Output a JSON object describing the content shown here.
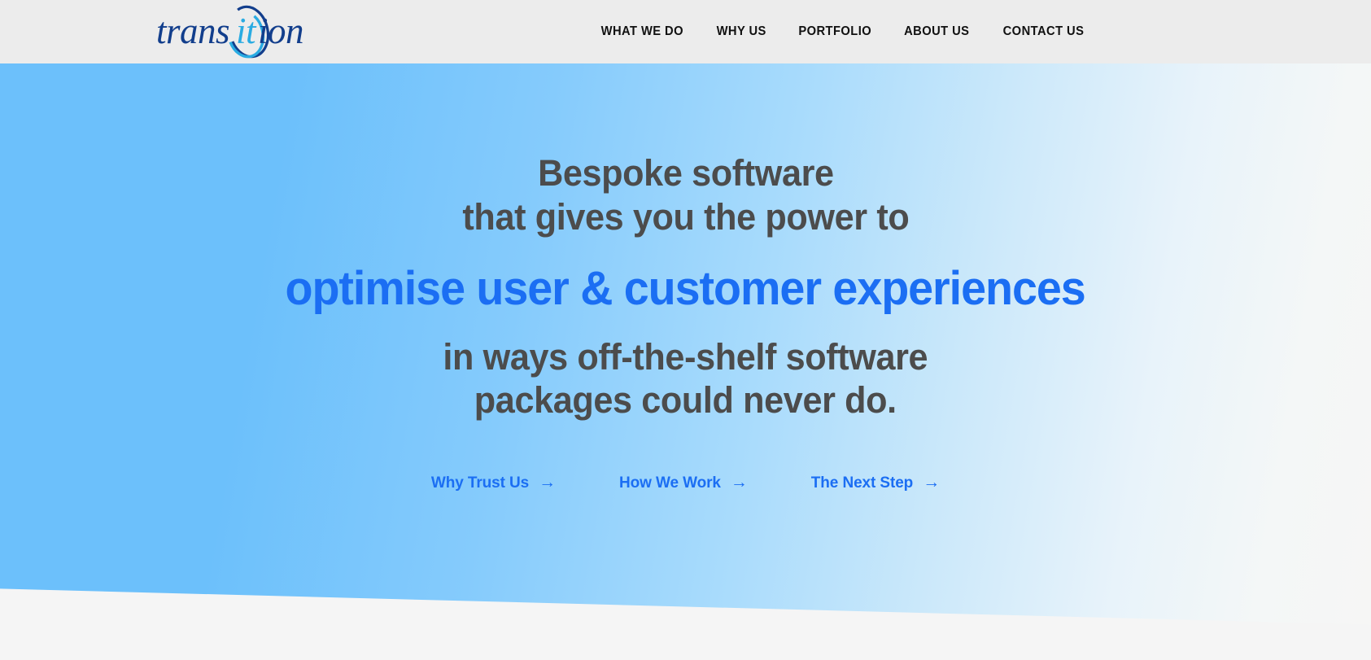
{
  "header": {
    "logo": {
      "name": "transition-logo",
      "text_part1": "trans",
      "text_part2": "it",
      "text_part3": "ion",
      "full_text": "transition",
      "color_dark": "#123E8C",
      "color_accent": "#29ABE2"
    },
    "nav": [
      {
        "label": "WHAT WE DO",
        "name": "nav-what-we-do"
      },
      {
        "label": "WHY US",
        "name": "nav-why-us"
      },
      {
        "label": "PORTFOLIO",
        "name": "nav-portfolio"
      },
      {
        "label": "ABOUT US",
        "name": "nav-about-us"
      },
      {
        "label": "CONTACT US",
        "name": "nav-contact-us"
      }
    ],
    "background_color": "#ECECEC"
  },
  "hero": {
    "headline_line1": "Bespoke software",
    "headline_line2": "that gives you the power to",
    "headline_accent": "optimise user & customer experiences",
    "headline_line3": "in ways off-the-shelf software",
    "headline_line4": "packages could never do.",
    "text_color": "#4C4C4C",
    "accent_color": "#1B6EF3",
    "gradient_from": "#6CC0FB",
    "gradient_to": "#F6F6F5",
    "ctas": [
      {
        "label": "Why Trust Us",
        "arrow": "→",
        "name": "cta-why-trust-us"
      },
      {
        "label": "How We Work",
        "arrow": "→",
        "name": "cta-how-we-work"
      },
      {
        "label": "The Next Step",
        "arrow": "→",
        "name": "cta-the-next-step"
      }
    ]
  },
  "page": {
    "background_color": "#F5F5F5"
  }
}
